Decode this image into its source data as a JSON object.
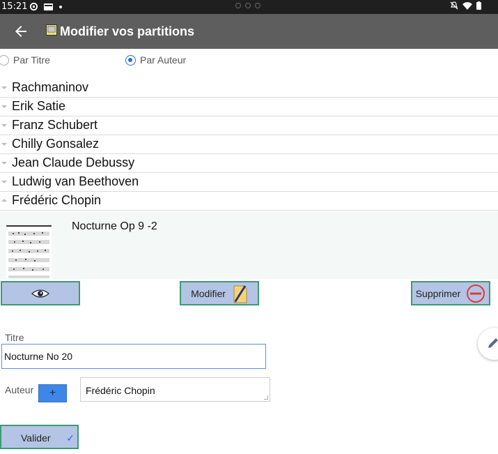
{
  "status_bar": {
    "time": "15:21",
    "left_icons": [
      "settings-icon",
      "folder-icon",
      "dot-icon"
    ],
    "right_icons": [
      "mute-icon",
      "wifi-icon",
      "battery-icon"
    ]
  },
  "app_bar": {
    "title": "Modifier vos partitions",
    "back_icon": "arrow-back-icon",
    "app_icon": "score-icon"
  },
  "sort": {
    "by_title_label": "Par Titre",
    "by_author_label": "Par Auteur",
    "selected": "Par Auteur"
  },
  "composers": [
    {
      "name": "Rachmaninov",
      "expanded": false
    },
    {
      "name": "Erik Satie",
      "expanded": false
    },
    {
      "name": "Franz Schubert",
      "expanded": false
    },
    {
      "name": "Chilly Gonsalez",
      "expanded": false
    },
    {
      "name": "Jean Claude Debussy",
      "expanded": false
    },
    {
      "name": "Ludwig van Beethoven",
      "expanded": false
    },
    {
      "name": "Frédéric Chopin",
      "expanded": true
    }
  ],
  "expanded_item": {
    "piece_title": "Nocturne Op 9 -2"
  },
  "actions": {
    "view_icon": "eye-icon",
    "modify_label": "Modifier",
    "modify_icon": "pencil-paper-icon",
    "delete_label": "Supprimer",
    "delete_icon": "minus-circle-icon"
  },
  "form": {
    "title_label": "Titre",
    "title_value": "Nocturne No 20",
    "author_label": "Auteur",
    "add_author_label": "+",
    "author_value": "Frédéric Chopin",
    "submit_label": "Valider",
    "submit_icon": "check-icon"
  },
  "colors": {
    "app_bar": "#5e5e5e",
    "button_bg": "#b4c4e4",
    "button_border": "#3b9b73",
    "accent": "#2a6fd6"
  }
}
